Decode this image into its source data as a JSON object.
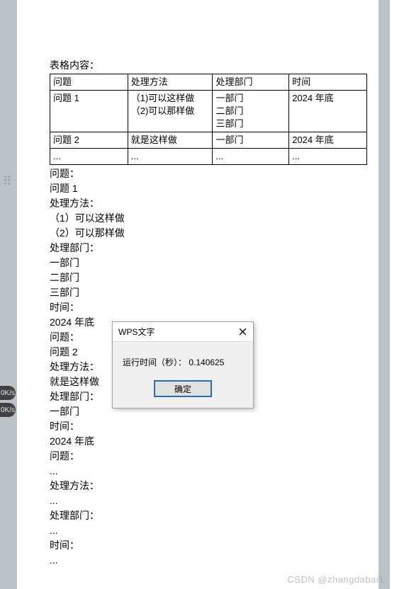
{
  "heading": "表格内容：",
  "table": {
    "header": [
      "问题",
      "处理方法",
      "处理部门",
      "时间"
    ],
    "rows": [
      {
        "c1": [
          "问题 1"
        ],
        "c2": [
          "（1)可以这样做",
          "（2)可以那样做"
        ],
        "c3": [
          "一部门",
          "二部门",
          "三部门"
        ],
        "c4": [
          "2024 年底"
        ]
      },
      {
        "c1": [
          "问题 2"
        ],
        "c2": [
          "就是这样做"
        ],
        "c3": [
          "一部门"
        ],
        "c4": [
          "2024 年底"
        ]
      },
      {
        "c1": [
          "..."
        ],
        "c2": [
          "..."
        ],
        "c3": [
          "..."
        ],
        "c4": [
          "..."
        ]
      }
    ]
  },
  "flow": [
    "问题：",
    "问题 1",
    "处理方法：",
    "（1）可以这样做",
    "（2）可以那样做",
    "处理部门：",
    "一部门",
    "二部门",
    "三部门",
    "时间：",
    "2024 年底",
    "问题：",
    "问题 2",
    "处理方法：",
    "就是这样做",
    "处理部门：",
    "一部门",
    "时间：",
    "2024 年底",
    "问题：",
    "...",
    "处理方法：",
    "...",
    "处理部门：",
    "...",
    "时间：",
    "..."
  ],
  "dialog": {
    "title": "WPS文字",
    "message": "运行时间（秒）： 0.140625",
    "ok": "确定"
  },
  "speed": {
    "v1": "0K/s",
    "v2": "0K/s"
  },
  "watermark": "CSDN @zhangdabai1"
}
